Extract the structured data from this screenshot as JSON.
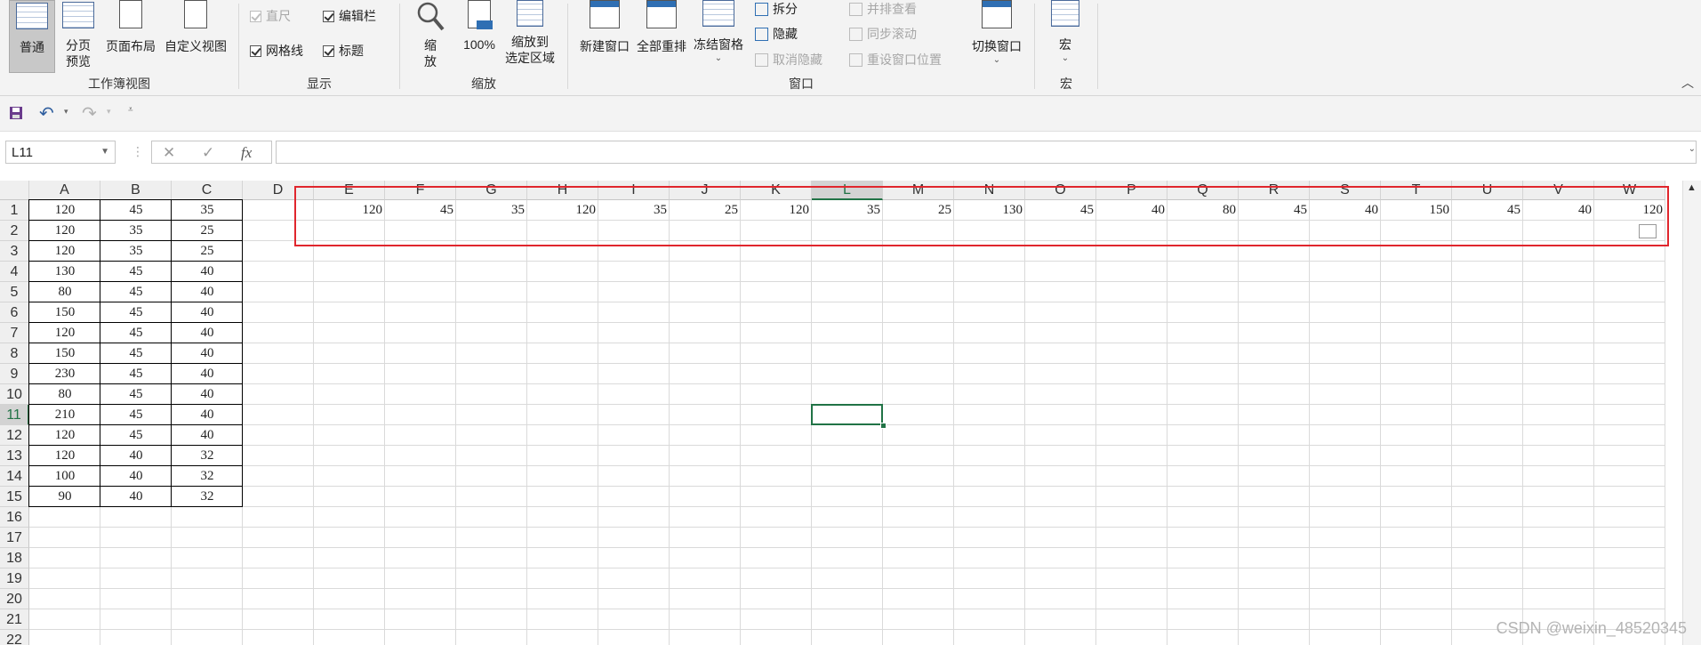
{
  "ribbon": {
    "workbook_views": {
      "label": "工作簿视图",
      "normal": "普通",
      "page_break_line1": "分页",
      "page_break_line2": "预览",
      "page_layout": "页面布局",
      "custom_views": "自定义视图"
    },
    "show": {
      "label": "显示",
      "ruler": "直尺",
      "formula_bar": "编辑栏",
      "gridlines": "网格线",
      "headings": "标题"
    },
    "zoom": {
      "label": "缩放",
      "zoom_line1": "缩",
      "zoom_line2": "放",
      "zoom_100": "100%",
      "zoom_to_sel_line1": "缩放到",
      "zoom_to_sel_line2": "选定区域"
    },
    "window": {
      "label": "窗口",
      "new_window": "新建窗口",
      "arrange_all": "全部重排",
      "freeze_panes": "冻结窗格",
      "split": "拆分",
      "hide": "隐藏",
      "unhide": "取消隐藏",
      "view_side_by_side": "并排查看",
      "sync_scroll": "同步滚动",
      "reset_position": "重设窗口位置",
      "switch_windows": "切换窗口"
    },
    "macros": {
      "label": "宏",
      "macros": "宏"
    }
  },
  "formula_bar": {
    "name_box": "L11",
    "fx": "fx",
    "cancel": "✕",
    "enter": "✓",
    "content": ""
  },
  "sheet": {
    "columns": [
      "A",
      "B",
      "C",
      "D",
      "E",
      "F",
      "G",
      "H",
      "I",
      "J",
      "K",
      "L",
      "M",
      "N",
      "O",
      "P",
      "Q",
      "R",
      "S",
      "T",
      "U",
      "V",
      "W"
    ],
    "selected_column": "L",
    "rows": [
      "1",
      "2",
      "3",
      "4",
      "5",
      "6",
      "7",
      "8",
      "9",
      "10",
      "11",
      "12",
      "13",
      "14",
      "15",
      "16",
      "17",
      "18",
      "19",
      "20",
      "21",
      "22"
    ],
    "selected_row": "11",
    "selected_cell": "L11",
    "table_ABC": [
      [
        "120",
        "45",
        "35"
      ],
      [
        "120",
        "35",
        "25"
      ],
      [
        "120",
        "35",
        "25"
      ],
      [
        "130",
        "45",
        "40"
      ],
      [
        "80",
        "45",
        "40"
      ],
      [
        "150",
        "45",
        "40"
      ],
      [
        "120",
        "45",
        "40"
      ],
      [
        "150",
        "45",
        "40"
      ],
      [
        "230",
        "45",
        "40"
      ],
      [
        "80",
        "45",
        "40"
      ],
      [
        "210",
        "45",
        "40"
      ],
      [
        "120",
        "45",
        "40"
      ],
      [
        "120",
        "40",
        "32"
      ],
      [
        "100",
        "40",
        "32"
      ],
      [
        "90",
        "40",
        "32"
      ]
    ],
    "row1_EtoW": [
      "120",
      "45",
      "35",
      "120",
      "35",
      "25",
      "120",
      "35",
      "25",
      "130",
      "45",
      "40",
      "80",
      "45",
      "40",
      "150",
      "45",
      "40",
      "120"
    ],
    "highlight_color": "#e0262d",
    "selection_color": "#217346"
  },
  "watermark": "CSDN @weixin_48520345"
}
